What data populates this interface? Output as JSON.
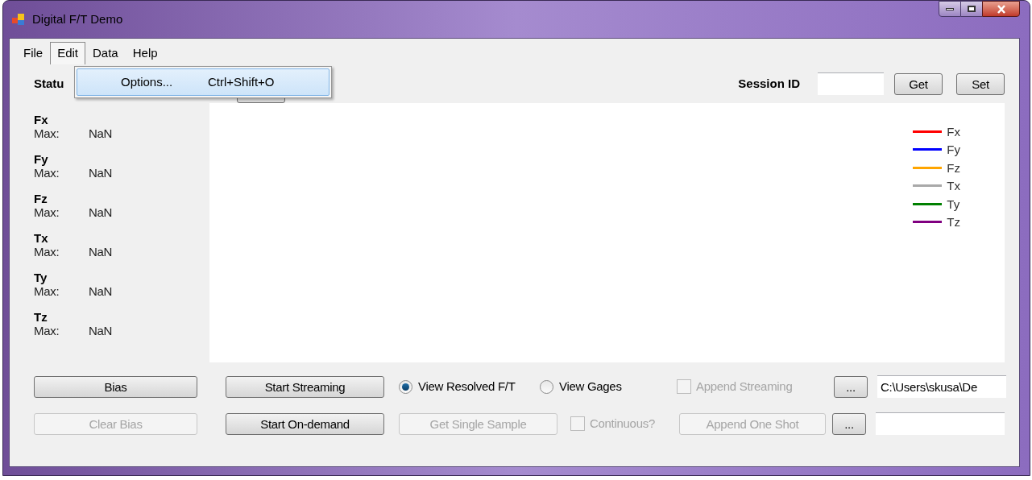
{
  "window": {
    "title": "Digital F/T Demo"
  },
  "menu": [
    {
      "label": "File",
      "selected": false
    },
    {
      "label": "Edit",
      "selected": true
    },
    {
      "label": "Data",
      "selected": false
    },
    {
      "label": "Help",
      "selected": false
    }
  ],
  "dropdown": [
    {
      "label": "Options...",
      "shortcut": "Ctrl+Shift+O",
      "selected": true
    }
  ],
  "status_label": "Statu",
  "session": {
    "label": "Session ID",
    "buttons": [
      {
        "label": "Get"
      },
      {
        "label": "Set"
      }
    ]
  },
  "channels": [
    {
      "name": "Fx",
      "max_label": "Max:",
      "max": "NaN"
    },
    {
      "name": "Fy",
      "max_label": "Max:",
      "max": "NaN"
    },
    {
      "name": "Fz",
      "max_label": "Max:",
      "max": "NaN"
    },
    {
      "name": "Tx",
      "max_label": "Max:",
      "max": "NaN"
    },
    {
      "name": "Ty",
      "max_label": "Max:",
      "max": "NaN"
    },
    {
      "name": "Tz",
      "max_label": "Max:",
      "max": "NaN"
    }
  ],
  "legend": [
    {
      "label": "Fx",
      "color": "#ff0000"
    },
    {
      "label": "Fy",
      "color": "#0000ff"
    },
    {
      "label": "Fz",
      "color": "#ffa500"
    },
    {
      "label": "Tx",
      "color": "#a9a9a9"
    },
    {
      "label": "Ty",
      "color": "#008000"
    },
    {
      "label": "Tz",
      "color": "#800080"
    }
  ],
  "bias_button": {
    "label": "Bias",
    "disabled": false
  },
  "clear_bias_button": {
    "label": "Clear Bias",
    "disabled": true
  },
  "start_streaming_button": {
    "label": "Start Streaming",
    "disabled": false
  },
  "start_on_demand_button": {
    "label": "Start On-demand",
    "disabled": false
  },
  "view_options": [
    {
      "label": "View Resolved F/T",
      "selected": true
    },
    {
      "label": "View Gages",
      "selected": false
    }
  ],
  "get_single_sample_button": {
    "label": "Get Single Sample",
    "disabled": true
  },
  "append_streaming": {
    "label": "Append Streaming",
    "checked": false,
    "disabled": true
  },
  "continuous": {
    "label": "Continuous?",
    "checked": false,
    "disabled": true
  },
  "append_one_shot_button": {
    "label": "Append One Shot",
    "disabled": true
  },
  "browse_buttons": [
    {
      "label": "...",
      "disabled": false
    },
    {
      "label": "...",
      "disabled": false
    }
  ],
  "path_field": {
    "value": "C:\\Users\\skusa\\De"
  }
}
